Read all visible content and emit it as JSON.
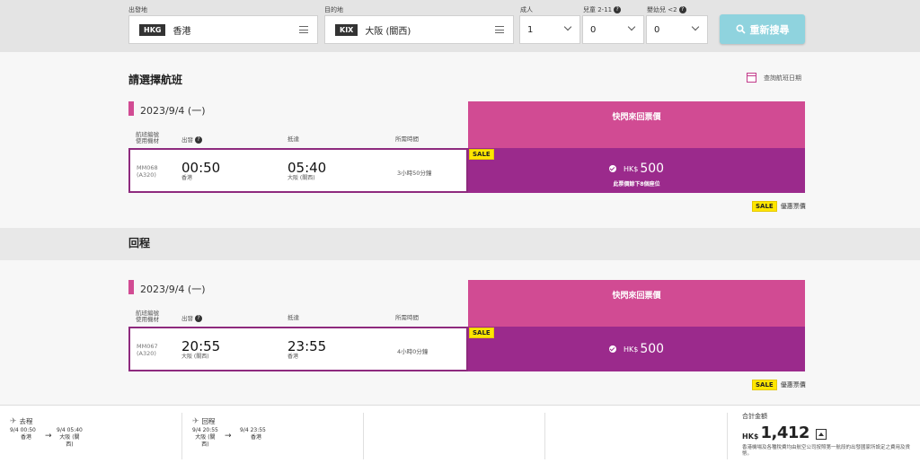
{
  "search": {
    "origin_label": "出發地",
    "origin_code": "HKG",
    "origin_city": "香港",
    "dest_label": "目的地",
    "dest_code": "KIX",
    "dest_city": "大阪 (關西)",
    "adult_label": "成人",
    "adult_value": "1",
    "child_label": "兒童 2-11",
    "child_value": "0",
    "infant_label": "嬰幼兒 <2",
    "infant_value": "0",
    "search_button": "重新搜尋",
    "help_glyph": "?"
  },
  "outbound": {
    "heading": "請選擇航班",
    "calendar_link": "查詢航班日期",
    "date": "2023/9/4 (一)",
    "fare_header": "快閃來回票價",
    "col_flight": "航班編號",
    "col_aircraft": "使用機材",
    "col_depart": "出發",
    "col_arrive": "抵達",
    "col_duration": "所需時間",
    "flight_no": "MM068",
    "aircraft": "(A320)",
    "dep_time": "00:50",
    "dep_place": "香港",
    "arr_time": "05:40",
    "arr_place": "大阪 (關西)",
    "duration": "3小時50分鐘",
    "sale_badge": "SALE",
    "currency": "HK$",
    "price": "500",
    "seats_note": "此票價餘下8個座位",
    "legend_sale": "SALE",
    "legend_text": "優惠票價"
  },
  "return": {
    "heading": "回程",
    "date": "2023/9/4 (一)",
    "fare_header": "快閃來回票價",
    "col_flight": "航班編號",
    "col_aircraft": "使用機材",
    "col_depart": "出發",
    "col_arrive": "抵達",
    "col_duration": "所需時間",
    "flight_no": "MM067",
    "aircraft": "(A320)",
    "dep_time": "20:55",
    "dep_place": "大阪 (關西)",
    "arr_time": "23:55",
    "arr_place": "香港",
    "duration": "4小時0分鐘",
    "sale_badge": "SALE",
    "currency": "HK$",
    "price": "500",
    "legend_sale": "SALE",
    "legend_text": "優惠票價"
  },
  "footer": {
    "outbound_title": "去程",
    "outbound_dep": "9/4 00:50",
    "outbound_dep_place": "香港",
    "outbound_arr": "9/4 05:40",
    "outbound_arr_place_1": "大阪 (關",
    "outbound_arr_place_2": "西)",
    "return_title": "回程",
    "return_dep": "9/4 20:55",
    "return_dep_place_1": "大阪 (關",
    "return_dep_place_2": "西)",
    "return_arr": "9/4 23:55",
    "return_arr_place": "香港",
    "arrow": "→",
    "plane_glyph": "✈",
    "total_label": "合計金額",
    "total_currency": "HK$",
    "total_amount": "1,412",
    "total_note": "香港機場及各種稅費均由航空公司按照第一航段的出發國家所設定之費用及貨幣。"
  },
  "colors": {
    "accent_pink": "#d14b93",
    "price_purple": "#9b2a8c",
    "search_button": "#8fd3de",
    "sale_yellow": "#ffe600"
  }
}
